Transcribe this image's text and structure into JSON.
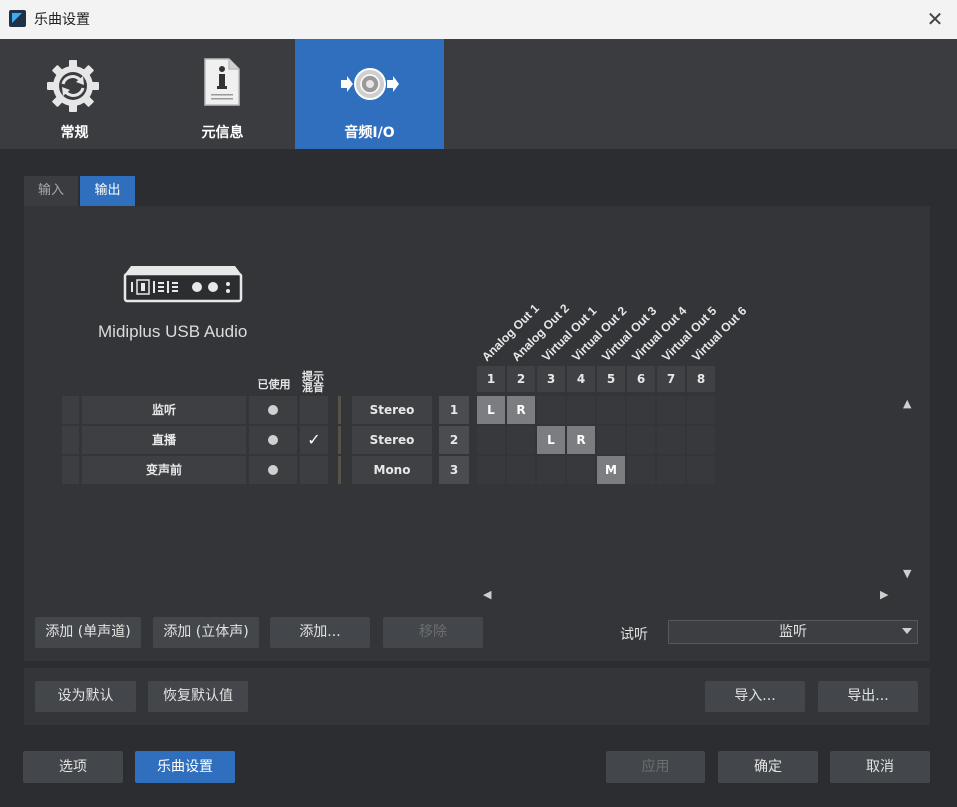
{
  "window": {
    "title": "乐曲设置",
    "close": "✕"
  },
  "top_tabs": [
    {
      "label": "常规",
      "icon": "gear-refresh-icon"
    },
    {
      "label": "元信息",
      "icon": "info-document-icon"
    },
    {
      "label": "音频I/O",
      "icon": "speaker-io-icon",
      "active": true
    }
  ],
  "sub_tabs": [
    {
      "label": "输入"
    },
    {
      "label": "输出",
      "active": true
    }
  ],
  "device": {
    "name": "Midiplus USB Audio",
    "icon": "audio-interface-icon"
  },
  "column_headers": {
    "used": "已使用",
    "cue_mix": "提示\n混音"
  },
  "channels": [
    {
      "name": "监听",
      "type": "Stereo",
      "num": "1",
      "cue_mix": false
    },
    {
      "name": "直播",
      "type": "Stereo",
      "num": "2",
      "cue_mix": true,
      "check": "✓"
    },
    {
      "name": "变声前",
      "type": "Mono",
      "num": "3",
      "cue_mix": false
    }
  ],
  "outputs": [
    {
      "num": "1",
      "name": "Analog Out 1"
    },
    {
      "num": "2",
      "name": "Analog Out 2"
    },
    {
      "num": "3",
      "name": "Virtual Out 1"
    },
    {
      "num": "4",
      "name": "Virtual Out 2"
    },
    {
      "num": "5",
      "name": "Virtual Out 3"
    },
    {
      "num": "6",
      "name": "Virtual Out 4"
    },
    {
      "num": "7",
      "name": "Virtual Out 5"
    },
    {
      "num": "8",
      "name": "Virtual Out 6"
    }
  ],
  "matrix": [
    {
      "row": 0,
      "col": 0,
      "label": "L"
    },
    {
      "row": 0,
      "col": 1,
      "label": "R"
    },
    {
      "row": 1,
      "col": 2,
      "label": "L"
    },
    {
      "row": 1,
      "col": 3,
      "label": "R"
    },
    {
      "row": 2,
      "col": 4,
      "label": "M"
    }
  ],
  "scroll_arrows": {
    "up": "▲",
    "down": "▼",
    "left": "◀",
    "right": "▶"
  },
  "buttons": {
    "add_mono": "添加 (单声道)",
    "add_stereo": "添加 (立体声)",
    "add": "添加...",
    "remove": "移除",
    "set_default": "设为默认",
    "restore_default": "恢复默认值",
    "import": "导入...",
    "export": "导出...",
    "options": "选项",
    "song_setup": "乐曲设置",
    "apply": "应用",
    "ok": "确定",
    "cancel": "取消"
  },
  "audition": {
    "label": "试听",
    "value": "监听"
  },
  "colors": {
    "accent": "#2f6fbe",
    "background": "#2b2d30",
    "panel": "#333538"
  }
}
